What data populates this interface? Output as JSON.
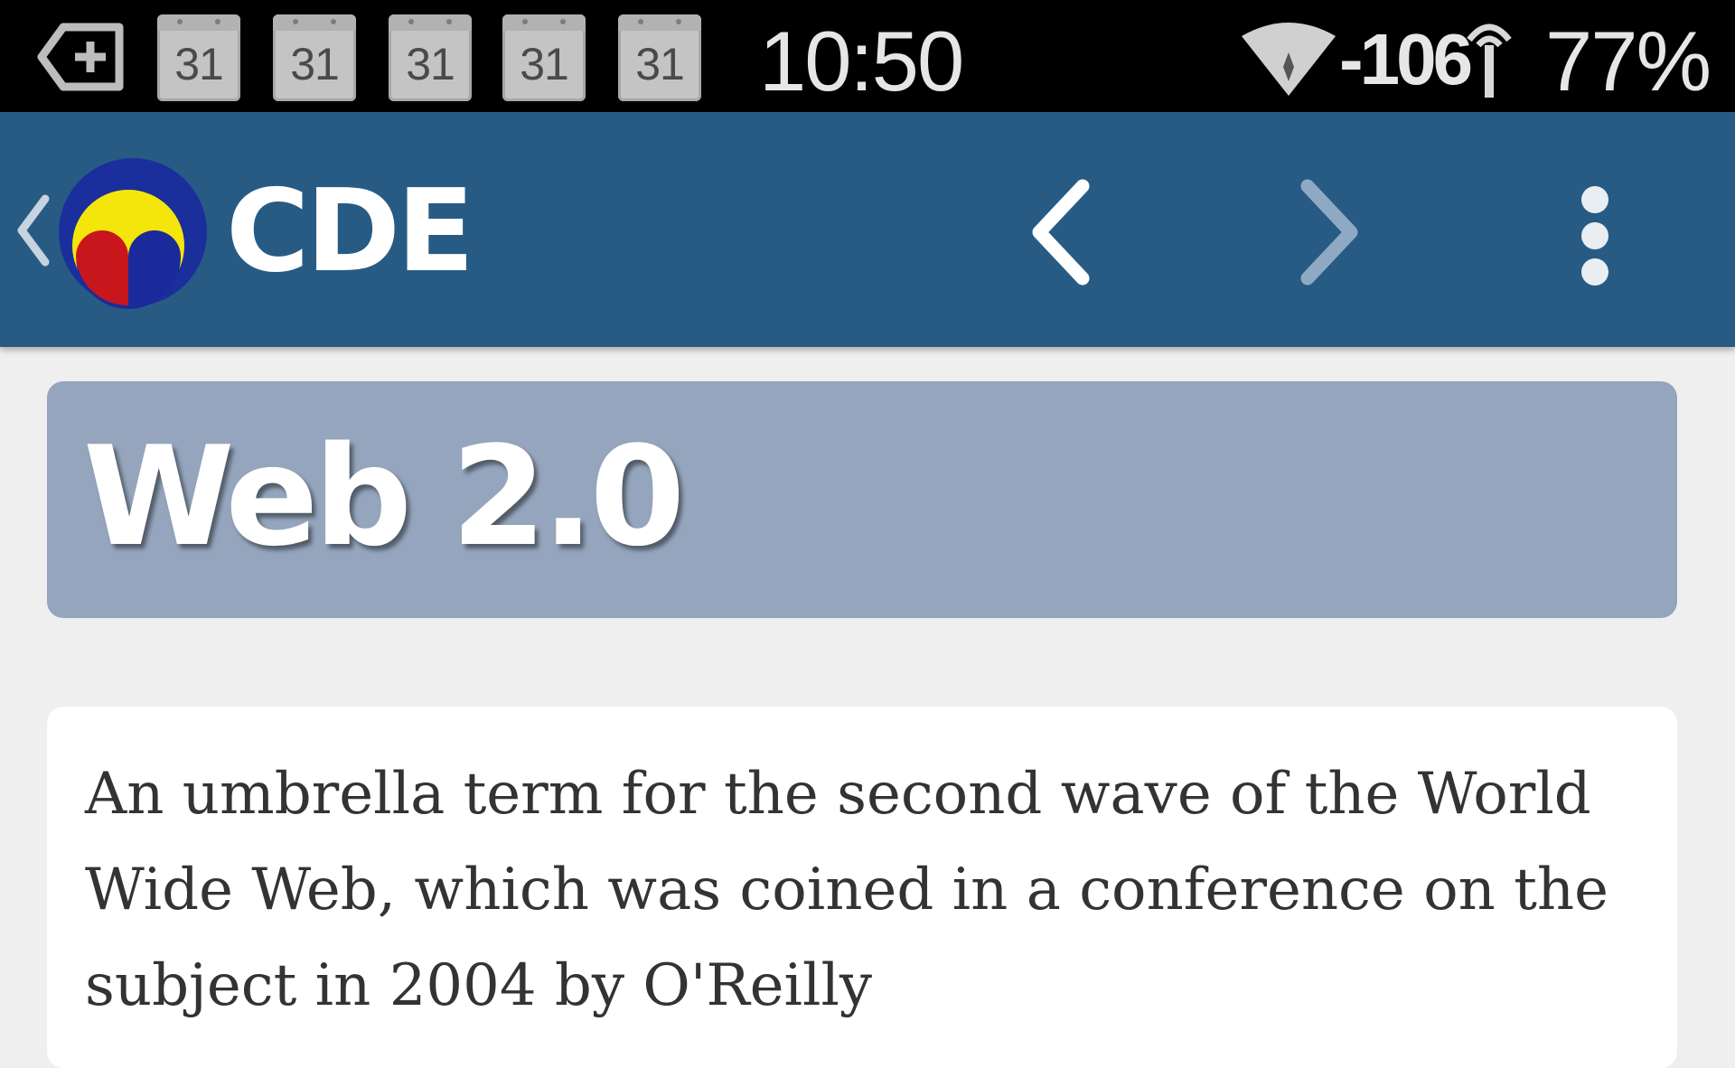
{
  "status_bar": {
    "notification_icons": [
      "notification-back-icon",
      "calendar-icon",
      "calendar-icon",
      "calendar-icon",
      "calendar-icon",
      "calendar-icon"
    ],
    "calendar_labels": [
      "31",
      "31",
      "31",
      "31",
      "31"
    ],
    "time": "10:50",
    "wifi_icon": "wifi-icon",
    "signal_strength": "-106",
    "antenna_icon": "antenna-icon",
    "battery": "77%"
  },
  "app_bar": {
    "up_icon": "chevron-left-icon",
    "logo_icon": "cde-logo",
    "title": "CDE",
    "back_icon": "chevron-left-icon",
    "forward_icon": "chevron-right-icon",
    "menu_icon": "more-vert-icon",
    "colors": {
      "bar": "#275b84",
      "back_arrow": "#ffffff",
      "forward_arrow": "#8fa9c4"
    }
  },
  "term": {
    "title": "Web 2.0",
    "banner_color": "#94a5bd"
  },
  "definition": {
    "text": "An umbrella term for the second wave of the World Wide Web, which was coined in a conference on the subject in 2004 by O'Reilly"
  }
}
